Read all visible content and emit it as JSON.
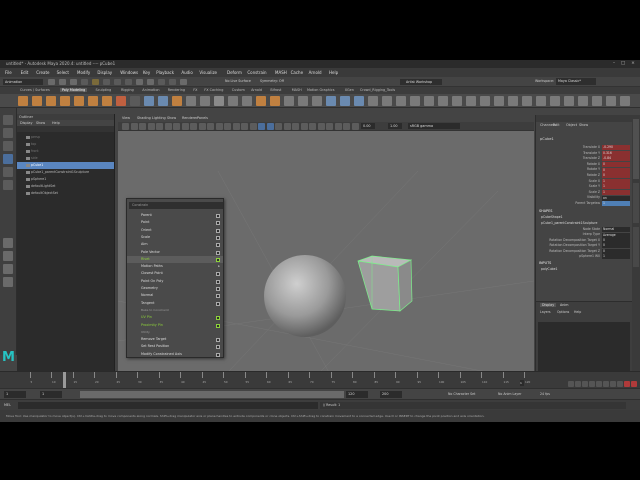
{
  "window": {
    "title": "untitled* - Autodesk Maya 2020.4: untitled ---- pCube1"
  },
  "menu": [
    "File",
    "Edit",
    "Create",
    "Select",
    "Modify",
    "Display",
    "Windows",
    "Key",
    "Playback",
    "Audio",
    "Visualize",
    "Deform",
    "Constrain",
    "MASH",
    "Cache",
    "Arnold",
    "Help"
  ],
  "status": {
    "menu_set": "Animation",
    "workspace_label": "Workspace:",
    "workspace": "Maya Classic*",
    "symmetry": "Symmetry: Off",
    "live_surface": "No Live Surface",
    "modeling_toolkit": "Artist Workshop"
  },
  "shelf_tabs": [
    "Curves / Surfaces",
    "Poly Modeling",
    "Sculpting",
    "Rigging",
    "Animation",
    "Rendering",
    "FX",
    "FX Caching",
    "Custom",
    "Arnold",
    "Bifrost",
    "MASH",
    "Motion Graphics",
    "XGen",
    "Crowd_Rigging_Tools"
  ],
  "shelf_active": "Poly Modeling",
  "outliner": {
    "title": "Outliner",
    "menu": [
      "Display",
      "Show",
      "Help"
    ],
    "items": [
      {
        "label": "persp",
        "dim": true
      },
      {
        "label": "top",
        "dim": true
      },
      {
        "label": "front",
        "dim": true
      },
      {
        "label": "side",
        "dim": true
      },
      {
        "label": "pCube1",
        "selected": true
      },
      {
        "label": "pCube1_parentConstraint1Sculpture",
        "dim": false
      },
      {
        "label": "pSphere1",
        "dim": false
      },
      {
        "label": "defaultLightSet",
        "dim": false
      },
      {
        "label": "defaultObjectSet",
        "dim": false
      }
    ]
  },
  "viewport": {
    "menu": [
      "View",
      "Shading",
      "Lighting",
      "Show",
      "Renderer",
      "Panels"
    ],
    "field1": "0.00",
    "field2": "1.00",
    "colorspace": "sRGB gamma",
    "camera_label": "persp"
  },
  "context_menu": {
    "search_placeholder": "Constrain",
    "items": [
      {
        "label": "Parent",
        "kind": "item"
      },
      {
        "label": "Point",
        "kind": "item"
      },
      {
        "label": "Orient",
        "kind": "item"
      },
      {
        "label": "Scale",
        "kind": "item"
      },
      {
        "label": "Aim",
        "kind": "item"
      },
      {
        "label": "Pole Vector",
        "kind": "item"
      },
      {
        "label": "Rivet",
        "kind": "green",
        "highlight": true
      },
      {
        "label": "Motion Paths",
        "kind": "sub"
      },
      {
        "label": "Closest Point",
        "kind": "item"
      },
      {
        "label": "Point On Poly",
        "kind": "item"
      },
      {
        "label": "Geometry",
        "kind": "item"
      },
      {
        "label": "Normal",
        "kind": "item"
      },
      {
        "label": "Tangent",
        "kind": "item"
      },
      {
        "label": "Bake to Constraint",
        "kind": "section"
      },
      {
        "label": "UV Pin",
        "kind": "green"
      },
      {
        "label": "Proximity Pin",
        "kind": "green"
      },
      {
        "label": "Utility",
        "kind": "section"
      },
      {
        "label": "Remove Target",
        "kind": "item"
      },
      {
        "label": "Set Rest Position",
        "kind": "item"
      },
      {
        "label": "Modify Constrained Axis",
        "kind": "item"
      }
    ]
  },
  "channel_box": {
    "tabs": [
      "Channels",
      "Edit",
      "Object",
      "Show"
    ],
    "object": "pCube1",
    "attrs": [
      {
        "k": "Translate X",
        "v": "-0.290",
        "style": "red"
      },
      {
        "k": "Translate Y",
        "v": "0.316",
        "style": "red"
      },
      {
        "k": "Translate Z",
        "v": "-0.84",
        "style": "red"
      },
      {
        "k": "Rotate X",
        "v": "0",
        "style": "red"
      },
      {
        "k": "Rotate Y",
        "v": "0",
        "style": "red"
      },
      {
        "k": "Rotate Z",
        "v": "0",
        "style": "red"
      },
      {
        "k": "Scale X",
        "v": "1",
        "style": "red"
      },
      {
        "k": "Scale Y",
        "v": "1",
        "style": "red"
      },
      {
        "k": "Scale Z",
        "v": "1",
        "style": "red"
      },
      {
        "k": "Visibility",
        "v": "on",
        "style": ""
      },
      {
        "k": "Parent Targetsw",
        "v": "1",
        "style": "blue"
      }
    ],
    "shapes_label": "SHAPES",
    "shapes": [
      "pCubeShape1",
      "pCube1_parentConstraint1Sculpture"
    ],
    "shape_attrs": [
      {
        "k": "Node State",
        "v": "Normal"
      },
      {
        "k": "Interp Type",
        "v": "Average"
      },
      {
        "k": "Rotation Decomposition Target X",
        "v": "0"
      },
      {
        "k": "Rotation Decomposition Target Y",
        "v": "0"
      },
      {
        "k": "Rotation Decomposition Target Z",
        "v": "0"
      },
      {
        "k": "pSphere1 W0",
        "v": "1"
      }
    ],
    "inputs_label": "INPUTS",
    "inputs": [
      "polyCube1"
    ],
    "layer_tabs": [
      "Display",
      "Anim"
    ],
    "layer_menu": [
      "Layers",
      "Options",
      "Help"
    ]
  },
  "timeline": {
    "ticks": [
      "5",
      "10",
      "15",
      "20",
      "25",
      "30",
      "35",
      "40",
      "45",
      "50",
      "55",
      "60",
      "65",
      "70",
      "75",
      "80",
      "85",
      "90",
      "95",
      "100",
      "105",
      "110",
      "115",
      "120"
    ],
    "current_frame": "1"
  },
  "range": {
    "start": "1",
    "inner_start": "1",
    "inner_end": "120",
    "end": "120",
    "end2": "200",
    "char_set": "No Character Set",
    "anim_layer": "No Anim Layer",
    "fps": "24 fps"
  },
  "cmd": {
    "lang": "MEL",
    "result": "// Result: 1"
  },
  "help": "Move Tool: Use manipulator to move object(s). Ctrl+middle-drag to move components along normals. Shift+drag manipulator axis or plane handles to extrude components or clone objects. Ctrl+Shift+drag to constrain movement to a connected edge. Use D or INSERT to change the pivot position and axis orientation.",
  "logo": "M",
  "colors": {
    "accent": "#5a86c0",
    "green": "#8dd13b",
    "keyed_red": "#8a3030"
  }
}
